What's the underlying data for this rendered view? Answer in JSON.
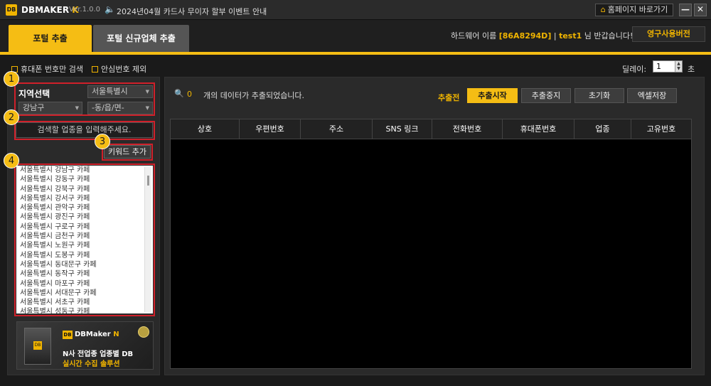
{
  "titlebar": {
    "logo": "DB",
    "app_name": "DBMAKER",
    "app_suffix": "K",
    "version": "Ver.1.0.0",
    "notice": "2024년04월 카드사 무이자 할부 이벤트 안내",
    "home_button": "홈페이지 바로가기",
    "minimize": "—",
    "close": "✕"
  },
  "tabs": [
    {
      "label": "포털 추출"
    },
    {
      "label": "포털 신규업체 추출"
    }
  ],
  "user": {
    "hw_prefix": "하드웨어 이름",
    "hw_id": "[86A8294D]",
    "separator": "|",
    "username": "test1",
    "greeting": "님 반갑습니다!",
    "license_button": "영구사용버전"
  },
  "options": {
    "mobile_only": "휴대폰 번호만 검색",
    "exclude_safe": "안심번호 제외",
    "delay_label": "딜레이:",
    "delay_value": "1",
    "delay_unit": "초"
  },
  "left": {
    "markers": [
      "1",
      "2",
      "3",
      "4"
    ],
    "region_title": "지역선택",
    "city_select": "서울특별시",
    "district_select": "강남구",
    "dong_select": "-동/읍/면-",
    "keyword_placeholder": "검색할 업종을 입력해주세요.",
    "keyword_button": "키워드 추가",
    "list_items": [
      "서울특별시 강남구 카페",
      "서울특별시 강동구 카페",
      "서울특별시 강북구 카페",
      "서울특별시 강서구 카페",
      "서울특별시 관악구 카페",
      "서울특별시 광진구 카페",
      "서울특별시 구로구 카페",
      "서울특별시 금천구 카페",
      "서울특별시 노원구 카페",
      "서울특별시 도봉구 카페",
      "서울특별시 동대문구 카페",
      "서울특별시 동작구 카페",
      "서울특별시 마포구 카페",
      "서울특별시 서대문구 카페",
      "서울특별시 서초구 카페",
      "서울특별시 성동구 카페"
    ]
  },
  "ad": {
    "box_label": "DB",
    "logo_db": "DB",
    "logo_text": "DBMaker",
    "logo_suffix": "N",
    "line1": "N사 전업종 업종별 DB",
    "line2": "실시간 수집 솔루션"
  },
  "right": {
    "count": "0",
    "count_text": "개의 데이터가 추출되었습니다.",
    "status": "추출전",
    "buttons": {
      "start": "추출시작",
      "stop": "추출중지",
      "reset": "초기화",
      "excel": "엑셀저장"
    },
    "columns": [
      "상호",
      "우편번호",
      "주소",
      "SNS 링크",
      "전화번호",
      "휴대폰번호",
      "업종",
      "고유번호"
    ]
  },
  "colors": {
    "accent": "#f5bd14",
    "highlight_red": "#d0202a",
    "background": "#1a1a1a"
  }
}
